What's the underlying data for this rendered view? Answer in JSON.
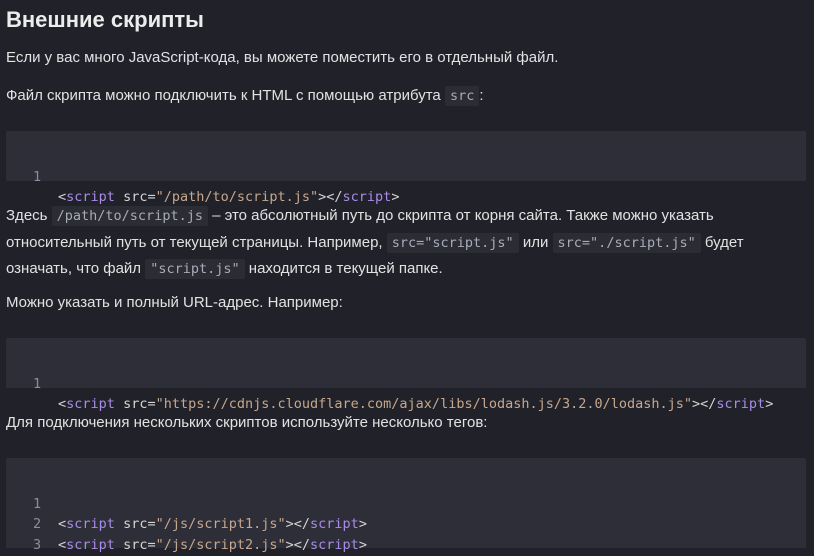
{
  "heading": "Внешние скрипты",
  "p1": "Если у вас много JavaScript-кода, вы можете поместить его в отдельный файл.",
  "p2": {
    "before": "Файл скрипта можно подключить к HTML с помощью атрибута",
    "code": "src",
    "after": ":"
  },
  "code1": {
    "lines": [
      {
        "n": "1",
        "tag": "script",
        "attr": "src",
        "value": "\"/path/to/script.js\""
      }
    ]
  },
  "p3": {
    "t1": "Здесь",
    "c1": "/path/to/script.js",
    "t2": "– это абсолютный путь до скрипта от корня сайта. Также можно указать",
    "t3": "относительный путь от текущей страницы. Например,",
    "c2": "src=\"script.js\"",
    "t4": "или",
    "c3": "src=\"./script.js\"",
    "t5": "будет",
    "t6": "означать, что файл",
    "c4": "\"script.js\"",
    "t7": "находится в текущей папке."
  },
  "p4": "Можно указать и полный URL-адрес. Например:",
  "code2": {
    "lines": [
      {
        "n": "1",
        "tag": "script",
        "attr": "src",
        "value": "\"https://cdnjs.cloudflare.com/ajax/libs/lodash.js/3.2.0/lodash.js\""
      }
    ]
  },
  "p5": "Для подключения нескольких скриптов используйте несколько тегов:",
  "code3": {
    "lines": [
      {
        "n": "1",
        "tag": "script",
        "attr": "src",
        "value": "\"/js/script1.js\""
      },
      {
        "n": "2",
        "tag": "script",
        "attr": "src",
        "value": "\"/js/script2.js\""
      },
      {
        "n": "3",
        "plain": "…"
      }
    ]
  }
}
